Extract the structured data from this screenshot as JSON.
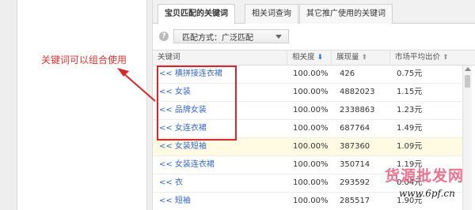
{
  "tabs": [
    {
      "label": "宝贝匹配的关键词",
      "active": true
    },
    {
      "label": "相关词查询",
      "active": false
    },
    {
      "label": "其它推广使用的关键词",
      "active": false
    }
  ],
  "filter": {
    "help_icon": "question-circle-icon",
    "match_label": "匹配方式：广泛匹配"
  },
  "table": {
    "headers": {
      "keyword": "关键词",
      "relevance": "相关度",
      "impressions": "展现量",
      "avg_price": "市场平均出价"
    },
    "rows": [
      {
        "keyword": "<< 横拼接连衣裙",
        "relevance": "100.00%",
        "impressions": "426",
        "price": "0.75元",
        "highlight": false
      },
      {
        "keyword": "<< 女装",
        "relevance": "100.00%",
        "impressions": "4882023",
        "price": "1.15元",
        "highlight": false
      },
      {
        "keyword": "<< 品牌女装",
        "relevance": "100.00%",
        "impressions": "2338863",
        "price": "1.23元",
        "highlight": false
      },
      {
        "keyword": "<< 女连衣裙",
        "relevance": "100.00%",
        "impressions": "687764",
        "price": "1.49元",
        "highlight": false
      },
      {
        "keyword": "<< 女装短袖",
        "relevance": "100.00%",
        "impressions": "387360",
        "price": "1.09元",
        "highlight": true
      },
      {
        "keyword": "<< 女装连衣裙",
        "relevance": "100.00%",
        "impressions": "350714",
        "price": "1.19元",
        "highlight": false
      },
      {
        "keyword": "<< 衣",
        "relevance": "100.00%",
        "impressions": "293592",
        "price": "0.04元",
        "highlight": false
      },
      {
        "keyword": "<< 短袖",
        "relevance": "100.00%",
        "impressions": "285517",
        "price": "1.90元",
        "highlight": false
      }
    ]
  },
  "annotation": {
    "text": "关键词可以组合使用",
    "color": "#e0322f"
  },
  "watermark": {
    "title": "货源批发网",
    "url": "www.6pf.cn"
  },
  "colors": {
    "link": "#3366cc",
    "highlight_row": "#fffbe3",
    "callout": "#d9262d"
  }
}
